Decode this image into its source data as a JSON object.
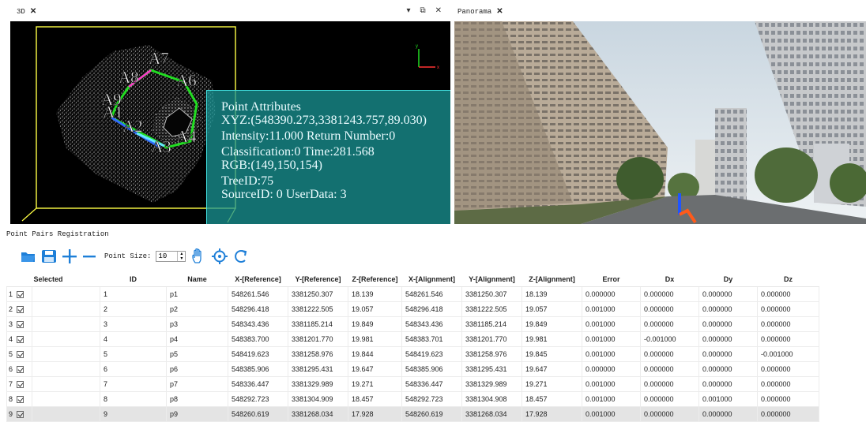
{
  "left_panel": {
    "tab_title": "3D",
    "close_glyph": "✕",
    "window_controls": "▾ ⧉ ✕"
  },
  "right_panel": {
    "tab_title": "Panorama",
    "close_glyph": "✕"
  },
  "point_labels": [
    "A7",
    "A8",
    "A6",
    "A9",
    "A1",
    "A2",
    "A3",
    "A4"
  ],
  "axis": {
    "y": "y",
    "x": "x"
  },
  "point_attributes": {
    "title": "Point Attributes",
    "xyz": "XYZ:(548390.273,3381243.757,89.030)",
    "intensity": "Intensity:11.000   Return Number:0",
    "classification": "Classification:0  Time:281.568",
    "rgb": "RGB:(149,150,154)",
    "tree_id": "TreeID:75",
    "source": "SourceID: 0  UserData: 3"
  },
  "section_title": "Point Pairs Registration",
  "toolbar": {
    "point_size_label": "Point Size:",
    "point_size_value": "10",
    "icons": [
      "folder-open-icon",
      "save-icon",
      "add-icon",
      "remove-icon",
      "hand-icon",
      "crosshair-icon",
      "refresh-icon"
    ]
  },
  "table": {
    "headers": [
      "Selected",
      "ID",
      "Name",
      "X-[Reference]",
      "Y-[Reference]",
      "Z-[Reference]",
      "X-[Alignment]",
      "Y-[Alignment]",
      "Z-[Alignment]",
      "Error",
      "Dx",
      "Dy",
      "Dz"
    ],
    "rows": [
      [
        "1",
        "1",
        "p1",
        "548261.546",
        "3381250.307",
        "18.139",
        "548261.546",
        "3381250.307",
        "18.139",
        "0.000000",
        "0.000000",
        "0.000000",
        "0.000000"
      ],
      [
        "2",
        "2",
        "p2",
        "548296.418",
        "3381222.505",
        "19.057",
        "548296.418",
        "3381222.505",
        "19.057",
        "0.001000",
        "0.000000",
        "0.000000",
        "0.000000"
      ],
      [
        "3",
        "3",
        "p3",
        "548343.436",
        "3381185.214",
        "19.849",
        "548343.436",
        "3381185.214",
        "19.849",
        "0.001000",
        "0.000000",
        "0.000000",
        "0.000000"
      ],
      [
        "4",
        "4",
        "p4",
        "548383.700",
        "3381201.770",
        "19.981",
        "548383.701",
        "3381201.770",
        "19.981",
        "0.001000",
        "-0.001000",
        "0.000000",
        "0.000000"
      ],
      [
        "5",
        "5",
        "p5",
        "548419.623",
        "3381258.976",
        "19.844",
        "548419.623",
        "3381258.976",
        "19.845",
        "0.001000",
        "0.000000",
        "0.000000",
        "-0.001000"
      ],
      [
        "6",
        "6",
        "p6",
        "548385.906",
        "3381295.431",
        "19.647",
        "548385.906",
        "3381295.431",
        "19.647",
        "0.000000",
        "0.000000",
        "0.000000",
        "0.000000"
      ],
      [
        "7",
        "7",
        "p7",
        "548336.447",
        "3381329.989",
        "19.271",
        "548336.447",
        "3381329.989",
        "19.271",
        "0.001000",
        "0.000000",
        "0.000000",
        "0.000000"
      ],
      [
        "8",
        "8",
        "p8",
        "548292.723",
        "3381304.909",
        "18.457",
        "548292.723",
        "3381304.908",
        "18.457",
        "0.001000",
        "0.000000",
        "0.001000",
        "0.000000"
      ],
      [
        "9",
        "9",
        "p9",
        "548260.619",
        "3381268.034",
        "17.928",
        "548260.619",
        "3381268.034",
        "17.928",
        "0.001000",
        "0.000000",
        "0.000000",
        "0.000000"
      ]
    ],
    "selected_row": 9
  },
  "colors": {
    "attr_box": "#1a9696",
    "bounding_box": "#ffff44",
    "polygon": "#22dd22",
    "point_cloud": "#cfcfcf",
    "toolbar_blue": "#1e7fd8"
  }
}
